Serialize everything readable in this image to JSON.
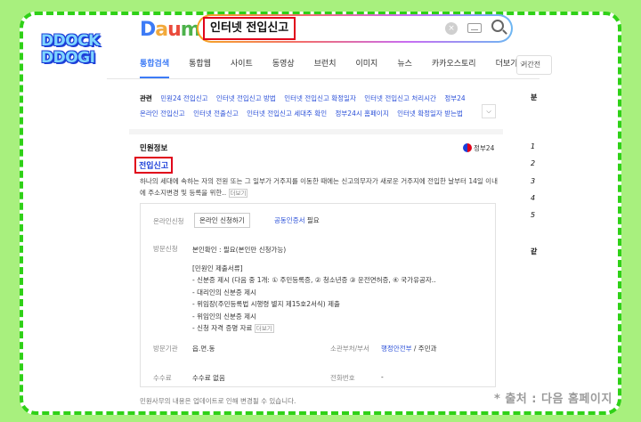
{
  "badge": {
    "line1": "DDOCK",
    "line2": "DDOGI"
  },
  "logo": {
    "d": "D",
    "a": "a",
    "u": "u",
    "m": "m"
  },
  "search": {
    "query": "인터넷 전입신고",
    "clear": "×"
  },
  "tabs": [
    {
      "label": "통합검색",
      "active": true
    },
    {
      "label": "통합웹"
    },
    {
      "label": "사이트"
    },
    {
      "label": "동영상"
    },
    {
      "label": "브런치"
    },
    {
      "label": "이미지"
    },
    {
      "label": "뉴스"
    },
    {
      "label": "카카오스토리"
    },
    {
      "label": "더보기 ⌵"
    }
  ],
  "period_label": "기간전",
  "related": {
    "label": "관련",
    "items": [
      "민원24 전입신고",
      "인터넷 전입신고 방법",
      "인터넷 전입신고 확정일자",
      "인터넷 전입신고 처리시간",
      "정부24",
      "온라인 전입신고",
      "인터넷 전출신고",
      "인터넷 전입신고 세대주 확인",
      "정부24시 홈페이지",
      "인터넷 확정일자 받는법"
    ],
    "expand": "⌵"
  },
  "section": {
    "title": "민원정보",
    "provider": "정부24"
  },
  "result": {
    "title": "전입신고",
    "desc": "하나의 세대에 속하는 자의 전원 또는 그 일부가 거주지를 이동한 때에는 신고의무자가 새로운 거주지에 전입한 날부터 14일 이내에 주소지변경 및 등록을 위한..",
    "more": "더보기"
  },
  "info": {
    "online_label": "온라인신청",
    "online_button": "온라인 신청하기",
    "cert_link": "공동인증서",
    "cert_text": "필요",
    "visit_label": "방문신청",
    "visit_lines": [
      "본인확인 : 필요(본인만 신청가능)",
      "",
      "[민원인 제출서류]",
      "- 신분증 제시 (다음 중 1개: ① 주민등록증, ② 청소년증 ③ 운전면허증, ④ 국가유공자..",
      "- 대리인의 신분증 제시",
      "- 위임장(주민등록법 시행령 별지 제15호2서식) 제출",
      "- 위임인의 신분증 제시",
      "- 신청 자격 증명 자료"
    ],
    "visit_more": "더보기",
    "org_label": "방문기관",
    "org_value": "읍.면.동",
    "dept_label": "소관부처/부서",
    "dept_link": "행정안전부",
    "dept_value": "/ 주민과",
    "fee_label": "수수료",
    "fee_value": "수수료 없음",
    "phone_label": "전화번호",
    "phone_value": "-"
  },
  "footer_note": "민원사무의 내용은 업데이트로 인해 변경될 수 있습니다.",
  "source": "* 출처 : 다음 홈페이지",
  "sidebar": {
    "head1": "분",
    "nums": [
      "1",
      "2",
      "3",
      "4",
      "5"
    ],
    "head2": "같"
  }
}
